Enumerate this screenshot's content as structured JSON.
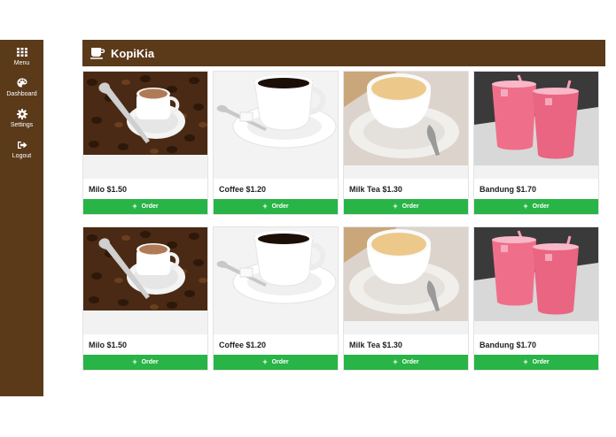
{
  "app": {
    "title": "KopiKia",
    "icon": "coffee-cup-icon"
  },
  "colors": {
    "brand_brown": "#5b3a1a",
    "order_green": "#28b446"
  },
  "sidebar": {
    "items": [
      {
        "label": "Menu",
        "icon": "grid-icon"
      },
      {
        "label": "Dashboard",
        "icon": "palette-icon"
      },
      {
        "label": "Settings",
        "icon": "gear-icon"
      },
      {
        "label": "Logout",
        "icon": "logout-icon"
      }
    ]
  },
  "products": [
    {
      "name": "Milo $1.50",
      "order_label": "Order",
      "image": "milo"
    },
    {
      "name": "Coffee $1.20",
      "order_label": "Order",
      "image": "coffee"
    },
    {
      "name": "Milk Tea $1.30",
      "order_label": "Order",
      "image": "milktea"
    },
    {
      "name": "Bandung $1.70",
      "order_label": "Order",
      "image": "bandung"
    },
    {
      "name": "Milo $1.50",
      "order_label": "Order",
      "image": "milo"
    },
    {
      "name": "Coffee $1.20",
      "order_label": "Order",
      "image": "coffee"
    },
    {
      "name": "Milk Tea $1.30",
      "order_label": "Order",
      "image": "milktea"
    },
    {
      "name": "Bandung $1.70",
      "order_label": "Order",
      "image": "bandung"
    }
  ]
}
